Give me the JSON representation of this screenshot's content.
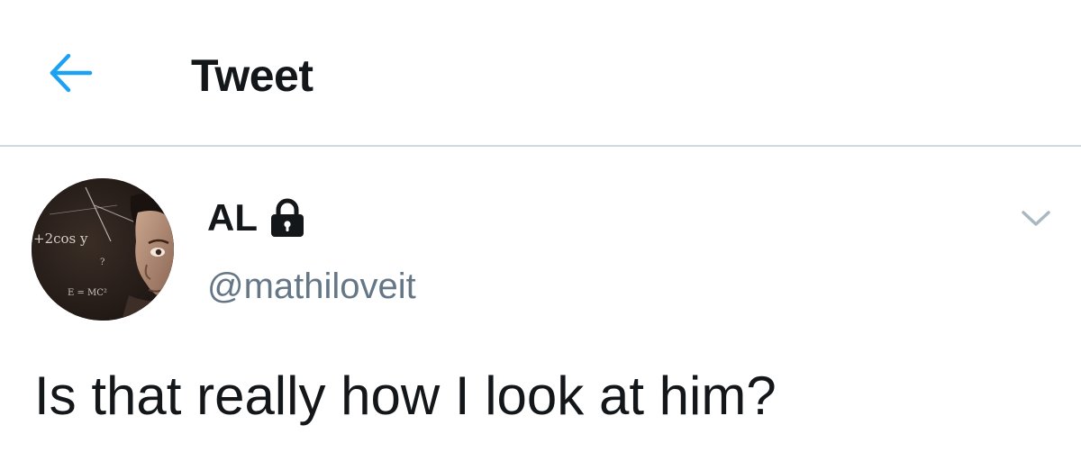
{
  "header": {
    "back_icon": "arrow-left-icon",
    "title": "Tweet"
  },
  "tweet": {
    "author": {
      "display_name": "AL",
      "handle": "@mathiloveit",
      "protected_icon": "lock-icon",
      "avatar": {
        "description_icon": "avatar-photo",
        "visible_formulas": [
          "+2cos y",
          "E = MC²",
          "?"
        ]
      }
    },
    "menu_icon": "chevron-down-icon",
    "text": "Is that really how I look at him?"
  },
  "colors": {
    "accent": "#1da1f2",
    "text_primary": "#14171a",
    "text_secondary": "#657786",
    "divider": "#cfd9de",
    "caret": "#aab8c2"
  }
}
